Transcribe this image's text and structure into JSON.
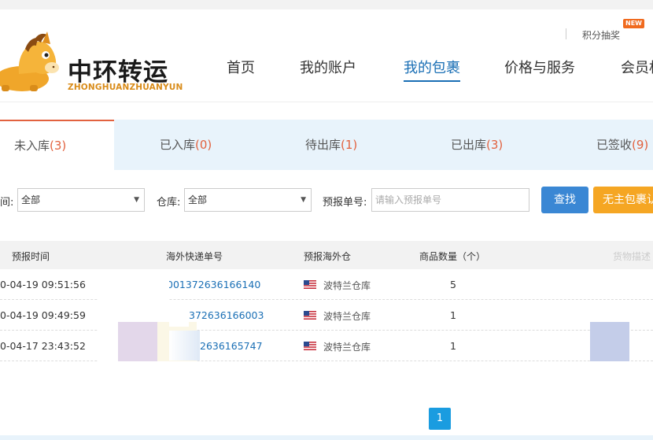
{
  "header": {
    "util_link": "积分抽奖",
    "new_badge": "NEW",
    "logo_title": "中环转运",
    "logo_subtitle": "ZHONGHUANZHUANYUN"
  },
  "nav": {
    "items": [
      {
        "label": "首页",
        "active": false
      },
      {
        "label": "我的账户",
        "active": false
      },
      {
        "label": "我的包裹",
        "active": true
      },
      {
        "label": "价格与服务",
        "active": false
      },
      {
        "label": "会员权",
        "active": false
      }
    ]
  },
  "tabs": [
    {
      "label": "未入库",
      "count": "(3)",
      "active": true
    },
    {
      "label": "已入库",
      "count": "(0)",
      "active": false
    },
    {
      "label": "待出库",
      "count": "(1)",
      "active": false
    },
    {
      "label": "已出库",
      "count": "(3)",
      "active": false
    },
    {
      "label": "已签收",
      "count": "(9)",
      "active": false
    }
  ],
  "filters": {
    "time_label": "间:",
    "time_value": "全部",
    "warehouse_label": "仓库:",
    "warehouse_value": "全部",
    "prereport_label": "预报单号:",
    "prereport_placeholder": "请输入预报单号",
    "search_button": "查找",
    "unclaimed_button": "无主包裹认"
  },
  "table": {
    "headers": [
      "预报时间",
      "海外快递单号",
      "预报海外仓",
      "商品数量（个）",
      "货物描述"
    ],
    "rows": [
      {
        "time": "0-04-19 09:51:56",
        "tracking": "001372636166140",
        "warehouse": "波特兰仓库",
        "qty": "5"
      },
      {
        "time": "0-04-19 09:49:59",
        "tracking": "372636166003",
        "warehouse": "波特兰仓库",
        "qty": "1"
      },
      {
        "time": "0-04-17 23:43:52",
        "tracking": "2636165747",
        "warehouse": "波特兰仓库",
        "qty": "1"
      }
    ]
  },
  "pagination": {
    "current": "1"
  },
  "colors": {
    "accent_blue": "#1a6fb5",
    "accent_orange": "#e2623f",
    "tab_bg": "#e8f3fb"
  }
}
